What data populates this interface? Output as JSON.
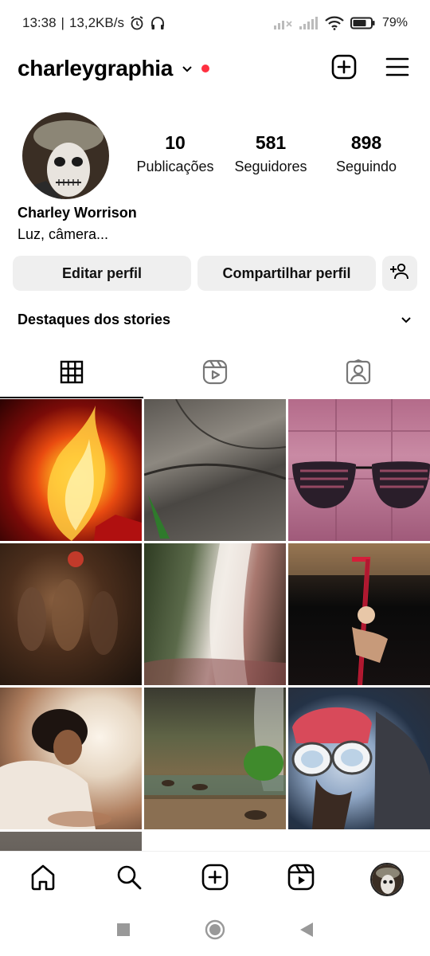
{
  "status_bar": {
    "time": "13:38",
    "separator": "|",
    "net_speed": "13,2KB/s",
    "battery": "79%",
    "icons": [
      "alarm-icon",
      "headphones-icon",
      "signal-off-icon",
      "signal-icon",
      "wifi-icon",
      "battery-icon"
    ]
  },
  "header": {
    "username": "charleygraphia",
    "icons": [
      "chevron-down-icon",
      "notification-dot",
      "new-post-icon",
      "menu-icon"
    ]
  },
  "profile": {
    "stats": [
      {
        "value": "10",
        "label": "Publicações"
      },
      {
        "value": "581",
        "label": "Seguidores"
      },
      {
        "value": "898",
        "label": "Seguindo"
      }
    ],
    "name": "Charley Worrison",
    "bio": "Luz, câmera..."
  },
  "buttons": {
    "edit": "Editar perfil",
    "share": "Compartilhar perfil",
    "discover_icon": "add-person-icon"
  },
  "highlights": {
    "title": "Destaques dos stories",
    "icon": "chevron-down-icon"
  },
  "tabs": [
    {
      "icon": "grid-icon",
      "active": true
    },
    {
      "icon": "reels-icon",
      "active": false
    },
    {
      "icon": "tagged-icon",
      "active": false
    }
  ],
  "grid": {
    "posts": [
      "fire",
      "leaf",
      "sunglasses",
      "crowd",
      "waterfall",
      "aerial-silk",
      "portrait",
      "forest-stream",
      "dog-helmet",
      "partial"
    ]
  },
  "bottom_nav": [
    "home-icon",
    "search-icon",
    "create-icon",
    "reels-icon",
    "profile-avatar"
  ],
  "system_nav": [
    "recent-apps-icon",
    "home-button-icon",
    "back-icon"
  ],
  "colors": {
    "accent_dot": "#ff3040",
    "button_bg": "#efefef",
    "text": "#000000"
  }
}
